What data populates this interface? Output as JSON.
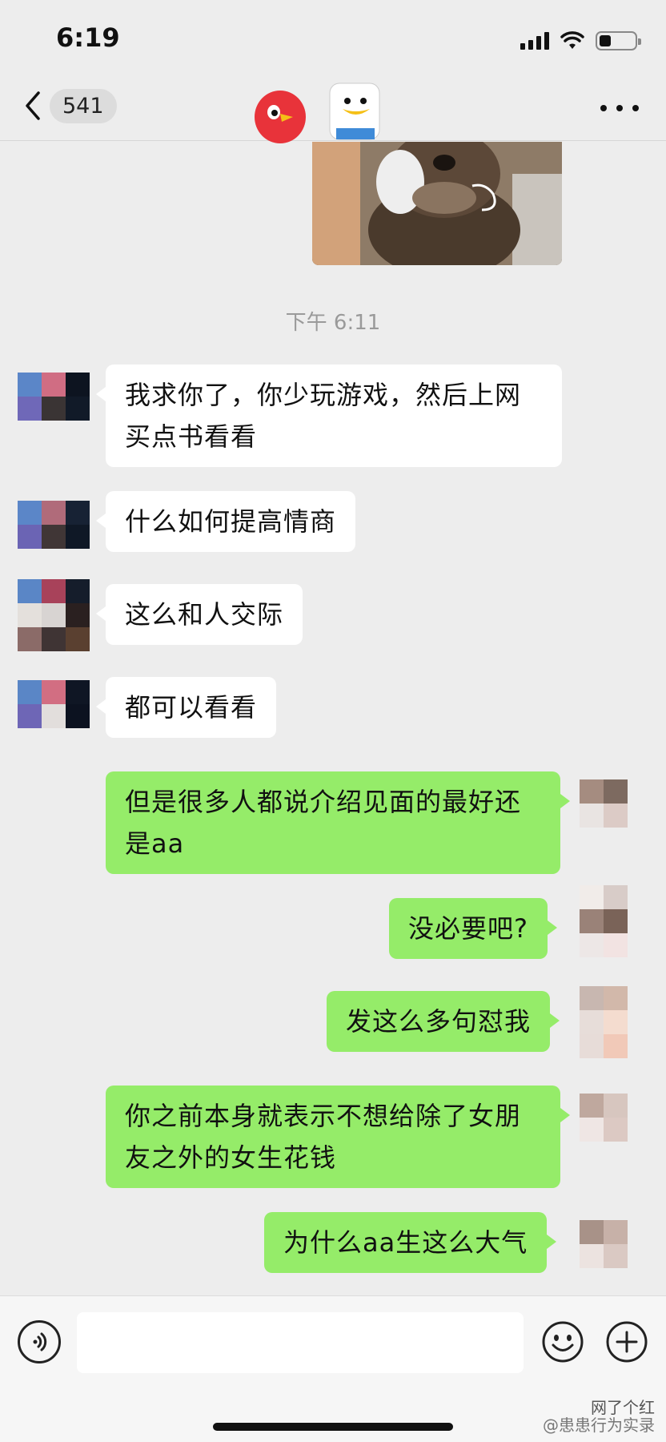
{
  "status_bar": {
    "time": "6:19"
  },
  "nav": {
    "unread_count": "541"
  },
  "timestamp": "下午 6:11",
  "messages": [
    {
      "side": "left",
      "text": "我求你了，你少玩游戏，然后上网买点书看看"
    },
    {
      "side": "left",
      "text": "什么如何提高情商"
    },
    {
      "side": "left",
      "text": "这么和人交际"
    },
    {
      "side": "left",
      "text": "都可以看看"
    },
    {
      "side": "right",
      "text": "但是很多人都说介绍见面的最好还是aa"
    },
    {
      "side": "right",
      "text": "没必要吧?"
    },
    {
      "side": "right",
      "text": "发这么多句怼我"
    },
    {
      "side": "right",
      "text": "你之前本身就表示不想给除了女朋友之外的女生花钱"
    },
    {
      "side": "right",
      "text": "为什么aa生这么大气"
    }
  ],
  "input": {
    "placeholder": ""
  },
  "icons": {
    "back": "chevron-left-icon",
    "more": "more-dots-icon",
    "voice": "voice-icon",
    "emoji": "emoji-icon",
    "plus": "plus-icon"
  },
  "colors": {
    "right_bubble": "#95ec69",
    "left_bubble": "#ffffff",
    "background": "#ededed"
  },
  "watermark": {
    "line1": "网了个红",
    "line2": "@患患行为实录"
  }
}
